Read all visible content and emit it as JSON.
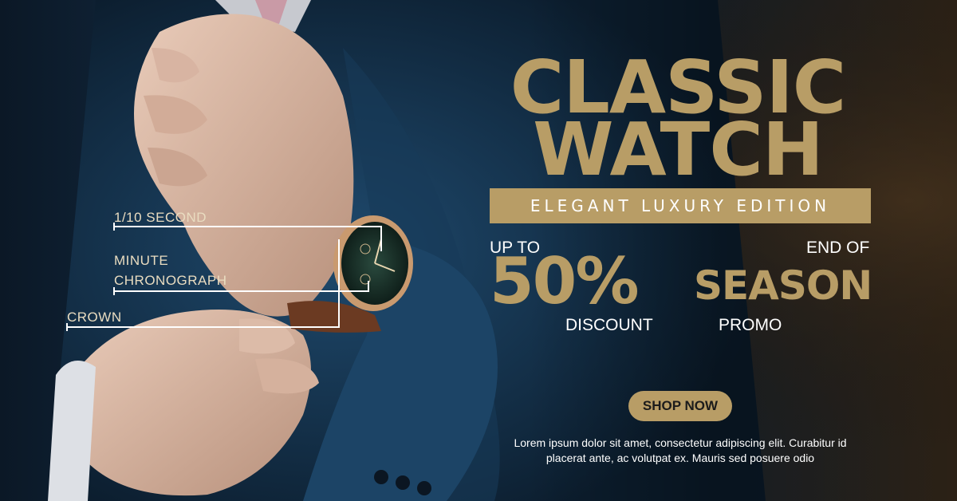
{
  "colors": {
    "gold": "#b89d66",
    "navy": "#14304a",
    "white": "#ffffff"
  },
  "callouts": {
    "second": "1/10 SECOND",
    "minute_line1": "MINUTE",
    "minute_line2": "CHRONOGRAPH",
    "crown": "CROWN"
  },
  "headline": {
    "line1": "CLASSIC",
    "line2": "WATCH"
  },
  "edition": "ELEGANT LUXURY EDITION",
  "offer": {
    "up_to": "UP TO",
    "percent": "50%",
    "discount": "DISCOUNT"
  },
  "season": {
    "end_of": "END OF",
    "season": "SEASON",
    "promo": "PROMO"
  },
  "cta": {
    "label": "SHOP NOW"
  },
  "body_text": {
    "line1": "Lorem ipsum dolor sit amet, consectetur adipiscing elit. Curabitur id",
    "line2": "placerat ante, ac volutpat ex. Mauris sed posuere odio"
  }
}
